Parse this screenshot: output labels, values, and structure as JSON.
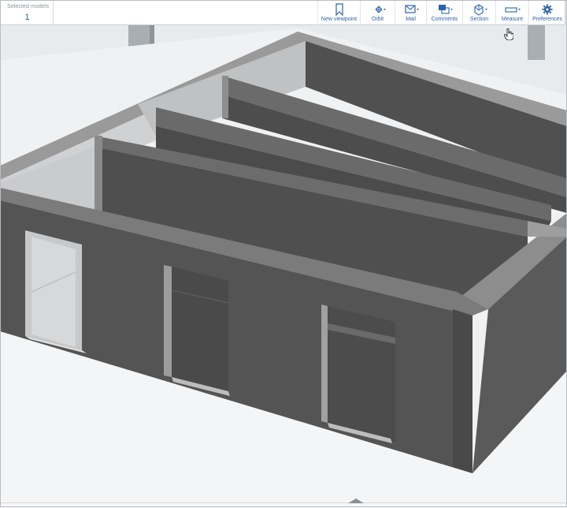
{
  "toolbar": {
    "selected_models_label": "Selected models",
    "selected_models_count": "1",
    "tools": [
      {
        "label": "New viewpoint",
        "icon": "bookmark-icon"
      },
      {
        "label": "Orbit",
        "icon": "orbit-move-icon"
      },
      {
        "label": "Mail",
        "icon": "mail-icon"
      },
      {
        "label": "Comments",
        "icon": "comments-icon"
      },
      {
        "label": "Section",
        "icon": "section-box-icon"
      },
      {
        "label": "Measure",
        "icon": "measure-ruler-icon"
      },
      {
        "label": "Preferences",
        "icon": "gear-icon"
      }
    ]
  },
  "colors": {
    "accent": "#2a64a8",
    "wall_dark": "#4e4e4e",
    "wall_top": "#7b7b7b",
    "floor": "#ececec",
    "background": "#e9ecef"
  }
}
